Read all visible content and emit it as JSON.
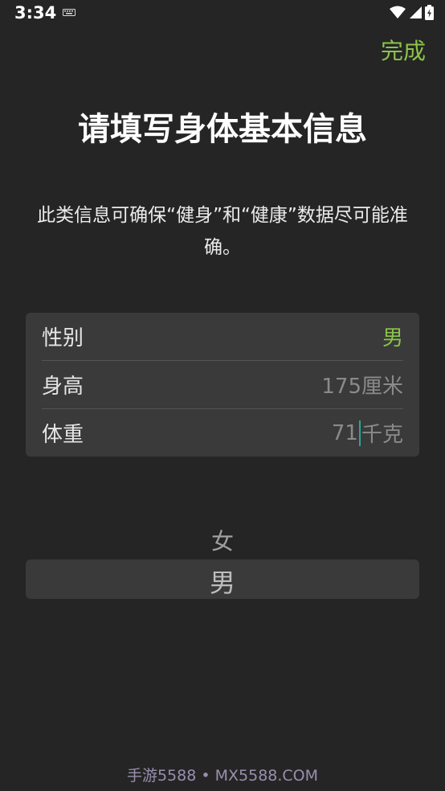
{
  "status_bar": {
    "time": "3:34"
  },
  "header": {
    "done_label": "完成"
  },
  "title": "请填写身体基本信息",
  "description": "此类信息可确保“健身”和“健康”数据尽可能准确。",
  "form": {
    "rows": [
      {
        "label": "性别",
        "value": "男"
      },
      {
        "label": "身高",
        "value": "175厘米"
      },
      {
        "label": "体重",
        "value_number": "71",
        "value_unit": "千克"
      }
    ]
  },
  "picker": {
    "options": [
      "女",
      "男"
    ],
    "selected": "男"
  },
  "watermark": "手游5588 • MX5588.COM",
  "colors": {
    "accent": "#8bc34a",
    "background": "#252525",
    "card": "#3a3a3a",
    "cursor": "#26a69a"
  }
}
